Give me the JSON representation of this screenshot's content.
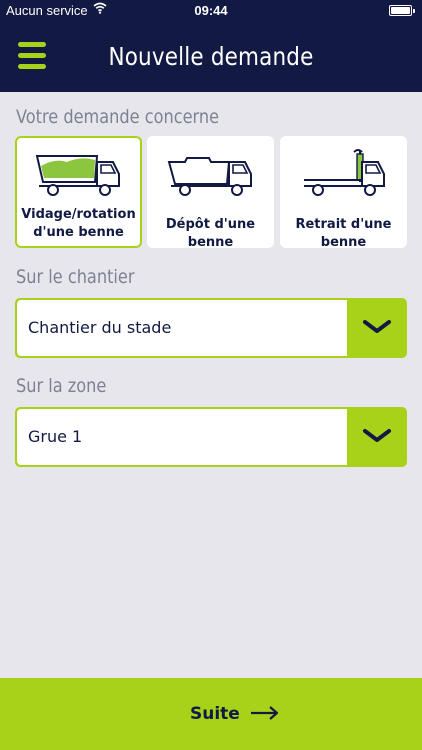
{
  "status_bar": {
    "carrier": "Aucun service",
    "time": "09:44"
  },
  "header": {
    "title": "Nouvelle demande"
  },
  "request_type": {
    "label": "Votre demande concerne",
    "options": [
      {
        "label": "Vidage/rotation d'une benne",
        "selected": true
      },
      {
        "label": "Dépôt d'une benne",
        "selected": false
      },
      {
        "label": "Retrait d'une benne",
        "selected": false
      }
    ]
  },
  "site": {
    "label": "Sur le chantier",
    "value": "Chantier du stade"
  },
  "zone": {
    "label": "Sur la zone",
    "value": "Grue 1"
  },
  "footer": {
    "next_label": "Suite"
  },
  "colors": {
    "navy": "#121a44",
    "accent": "#a7d219",
    "background": "#e6e6ec"
  }
}
